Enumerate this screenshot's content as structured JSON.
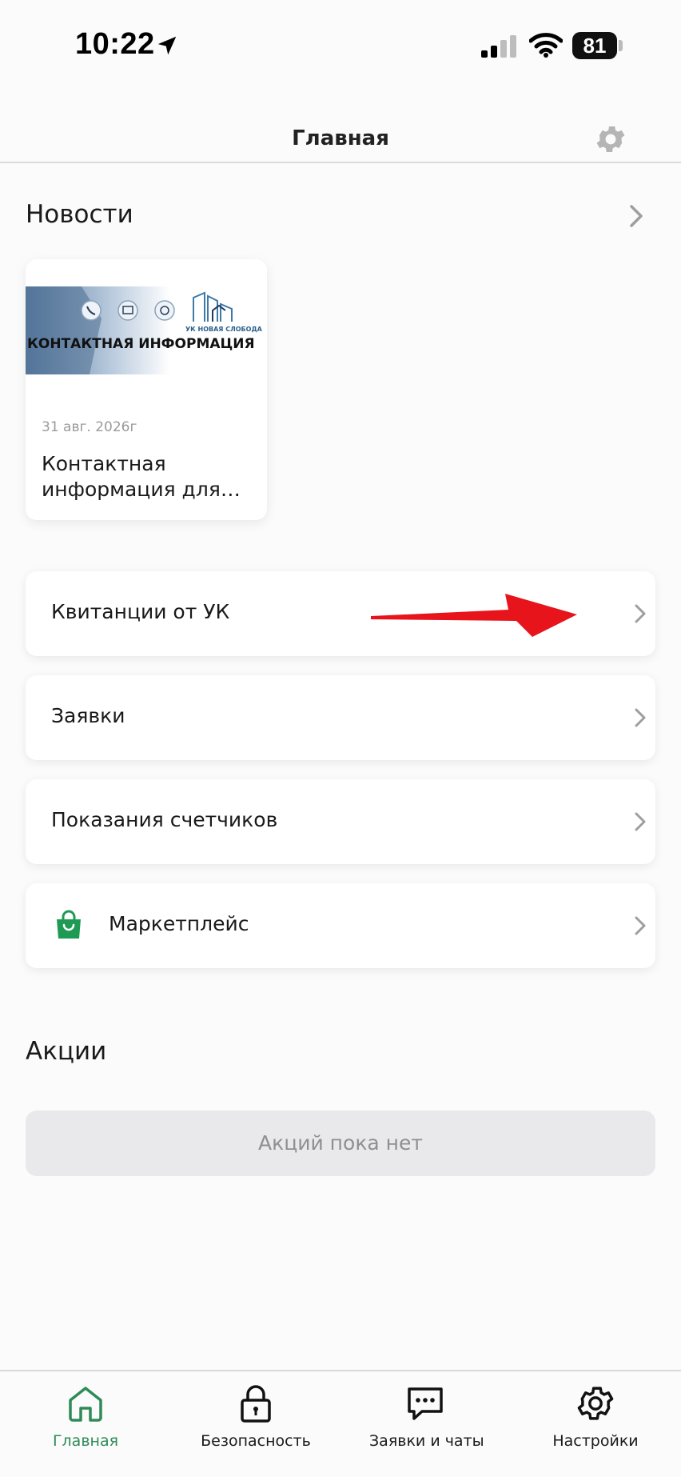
{
  "status_bar": {
    "time": "10:22",
    "battery": "81",
    "icons": [
      "location-arrow-icon",
      "signal-bars-icon",
      "wifi-icon",
      "battery-icon"
    ]
  },
  "header": {
    "title": "Главная",
    "settings_icon": "gear-icon"
  },
  "news": {
    "title": "Новости",
    "cards": [
      {
        "image_caption": "КОНТАКТНАЯ ИНФОРМАЦИЯ",
        "logo_text": "УК НОВАЯ СЛОБОДА",
        "date": "31 авг. 2026г",
        "text": "Контактная информация для…"
      }
    ]
  },
  "menu": {
    "items": [
      {
        "label": "Квитанции от УК"
      },
      {
        "label": "Заявки"
      },
      {
        "label": "Показания счетчиков"
      },
      {
        "label": "Маркетплейс",
        "icon": "shopping-bag-icon"
      }
    ]
  },
  "promotions": {
    "title": "Акции",
    "empty_text": "Акций пока нет"
  },
  "tabbar": {
    "tabs": [
      {
        "label": "Главная",
        "icon": "home-icon",
        "active": true
      },
      {
        "label": "Безопасность",
        "icon": "lock-icon"
      },
      {
        "label": "Заявки и чаты",
        "icon": "chat-bubble-icon"
      },
      {
        "label": "Настройки",
        "icon": "gear-icon"
      }
    ]
  },
  "colors": {
    "accent": "#2e8b57",
    "annotation_arrow": "#e8141c",
    "background": "#fbfbfb",
    "empty_state_bg": "#e9e9ec"
  }
}
